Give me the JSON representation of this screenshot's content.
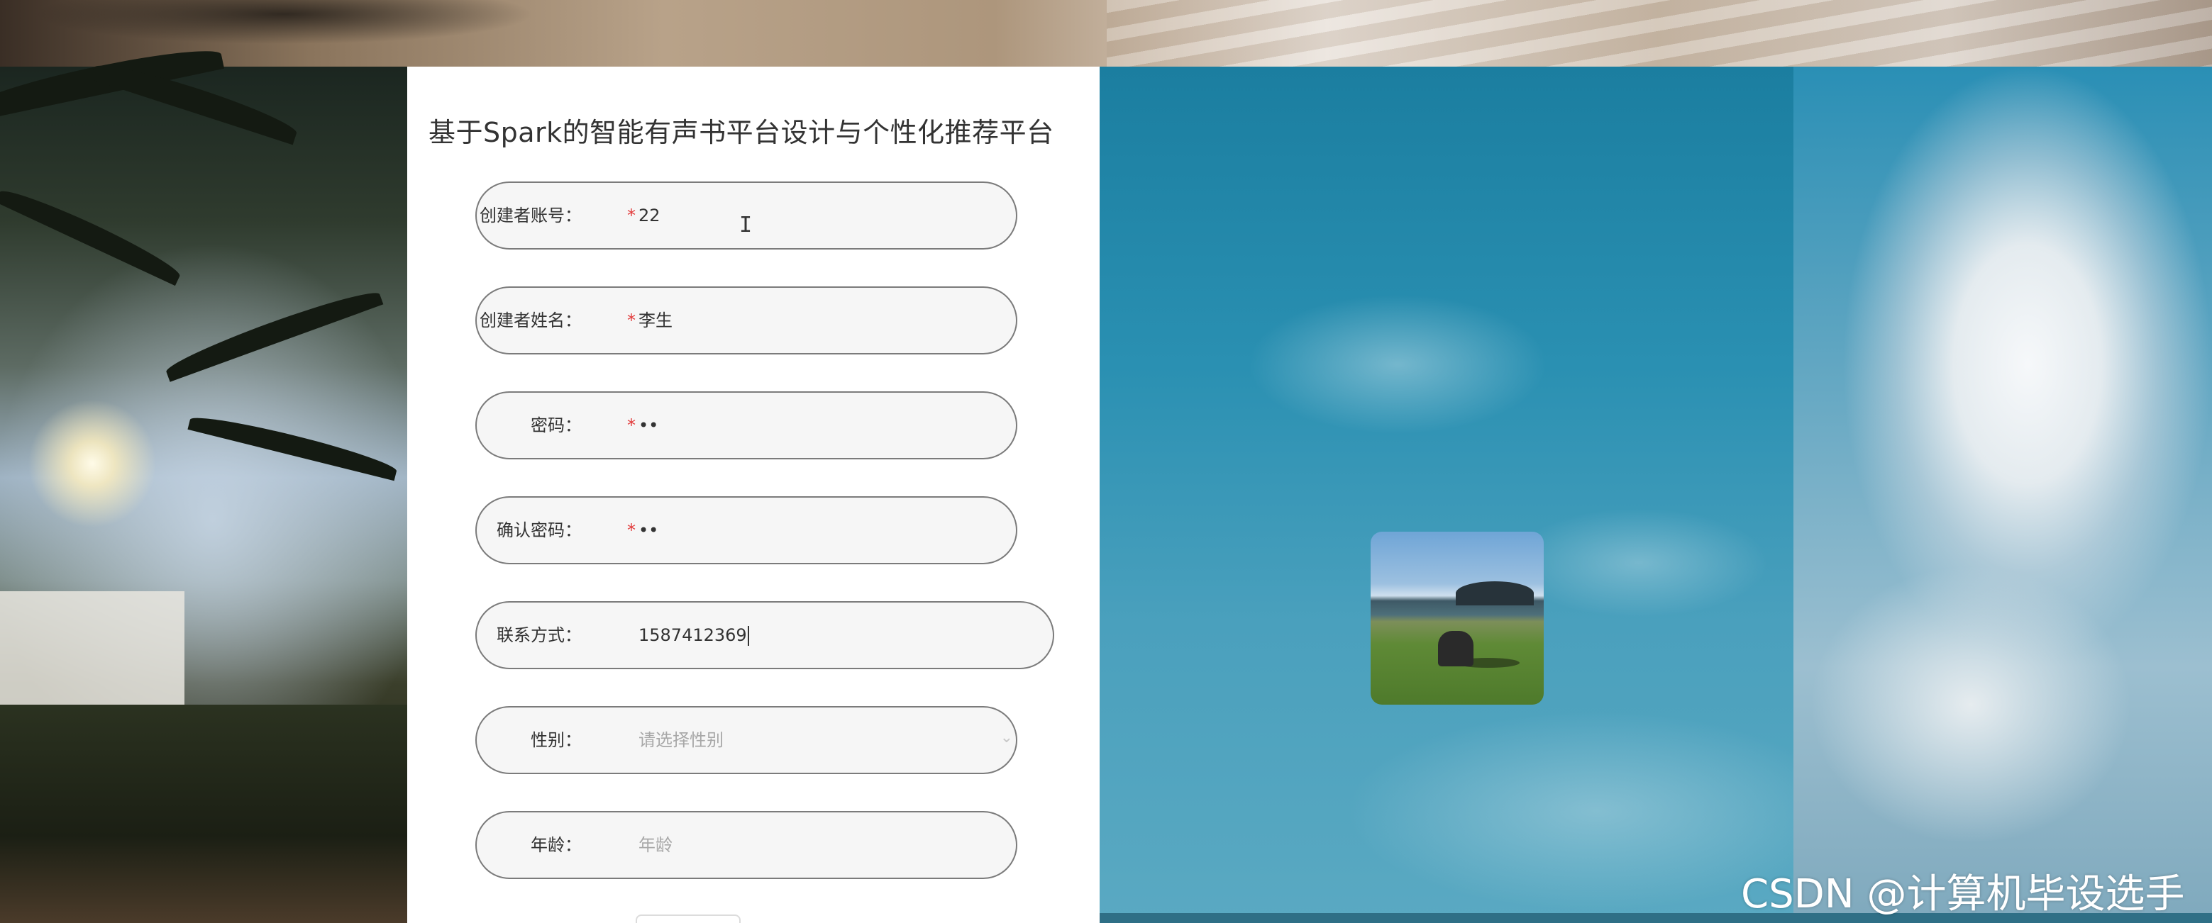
{
  "page": {
    "title": "基于Spark的智能有声书平台设计与个性化推荐平台"
  },
  "form": {
    "fields": [
      {
        "label": "创建者账号：",
        "required": "*",
        "value": "22"
      },
      {
        "label": "创建者姓名：",
        "required": "*",
        "value": "李生"
      },
      {
        "label": "密码：",
        "required": "*",
        "value": "••"
      },
      {
        "label": "确认密码：",
        "required": "*",
        "value": "••"
      },
      {
        "label": "联系方式：",
        "value": "1587412369"
      },
      {
        "label": "性别：",
        "placeholder": "请选择性别"
      },
      {
        "label": "年龄：",
        "placeholder": "年龄"
      }
    ]
  },
  "cursor": {
    "glyph": "I"
  },
  "watermark": {
    "text": "CSDN @计算机毕设选手"
  },
  "icons": {
    "select_chevron": "chevron-down-icon"
  },
  "colors": {
    "required": "#e23b3b",
    "field_border": "#7b7b7b",
    "field_bg": "#f6f6f6",
    "placeholder": "#a8a8a8"
  }
}
